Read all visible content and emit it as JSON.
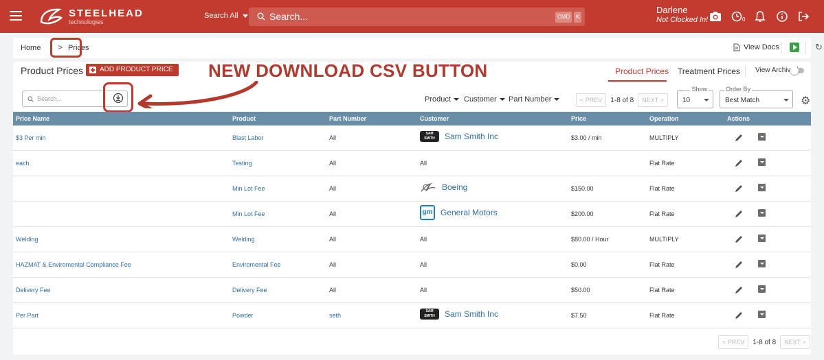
{
  "topbar": {
    "logo_title": "STEELHEAD",
    "logo_subtitle": "technologies",
    "search_scope": "Search All",
    "search_placeholder": "Search...",
    "kbd_cmd": "CMD",
    "kbd_k": "K",
    "user_name": "Darlene",
    "user_status": "Not Clocked In!",
    "timer_count": "0"
  },
  "breadcrumb": {
    "home": "Home",
    "separator": ">",
    "current": "Prices",
    "view_docs": "View Docs"
  },
  "header": {
    "title": "Product Prices",
    "add_button": "ADD PRODUCT PRICE",
    "tabs": [
      "Product Prices",
      "Treatment Prices"
    ],
    "view_archived": "View Archived"
  },
  "annotation": {
    "text": "NEW DOWNLOAD CSV BUTTON",
    "color": "#b5382c"
  },
  "toolbar": {
    "search_placeholder": "Search...",
    "filters": [
      "Product",
      "Customer",
      "Part Number"
    ],
    "prev": "< PREV",
    "next": "NEXT >",
    "range": "1-8 of 8",
    "show_label": "Show",
    "show_value": "10",
    "order_label": "Order By",
    "order_value": "Best Match"
  },
  "table": {
    "columns": [
      "Price Name",
      "Product",
      "Part Number",
      "Customer",
      "Price",
      "Operation",
      "Actions"
    ],
    "rows": [
      {
        "price_name": "$3 Per min",
        "product": "Blast Labor",
        "part_number": "All",
        "customer": "Sam Smith Inc",
        "customer_logo": "sam-smith",
        "price": "$3.00 / min",
        "operation": "MULTIPLY"
      },
      {
        "price_name": "each",
        "product": "Testing",
        "part_number": "All",
        "customer": "All",
        "customer_logo": "",
        "price": "",
        "operation": "Flat Rate"
      },
      {
        "price_name": "",
        "product": "Min Lot Fee",
        "part_number": "All",
        "customer": "Boeing",
        "customer_logo": "boeing",
        "price": "$150.00",
        "operation": "Flat Rate"
      },
      {
        "price_name": "",
        "product": "Min Lot Fee",
        "part_number": "All",
        "customer": "General Motors",
        "customer_logo": "gm",
        "price": "$200.00",
        "operation": "Flat Rate"
      },
      {
        "price_name": "Welding",
        "product": "Welding",
        "part_number": "All",
        "customer": "All",
        "customer_logo": "",
        "price": "$80.00 / Hour",
        "operation": "MULTIPLY"
      },
      {
        "price_name": "HAZMAT & Enviromental Compliance Fee",
        "product": "Enviromental Fee",
        "part_number": "All",
        "customer": "All",
        "customer_logo": "",
        "price": "$0.00",
        "operation": "Flat Rate"
      },
      {
        "price_name": "Delivery Fee",
        "product": "Delivery Fee",
        "part_number": "All",
        "customer": "All",
        "customer_logo": "",
        "price": "$50.00",
        "operation": "Flat Rate"
      },
      {
        "price_name": "Per Part",
        "product": "Powder",
        "part_number": "seth",
        "customer": "Sam Smith Inc",
        "customer_logo": "sam-smith",
        "price": "$7.50",
        "operation": "Flat Rate"
      }
    ]
  },
  "footer_pager": {
    "prev": "< PREV",
    "range": "1-8 of 8",
    "next": "NEXT >"
  },
  "logos": {
    "sam_smith_text": "SAM SMITH",
    "gm_text": "gm"
  },
  "colors": {
    "brand": "#c23b2e",
    "header_row": "#6b8ea8",
    "link": "#2f6fa8"
  }
}
